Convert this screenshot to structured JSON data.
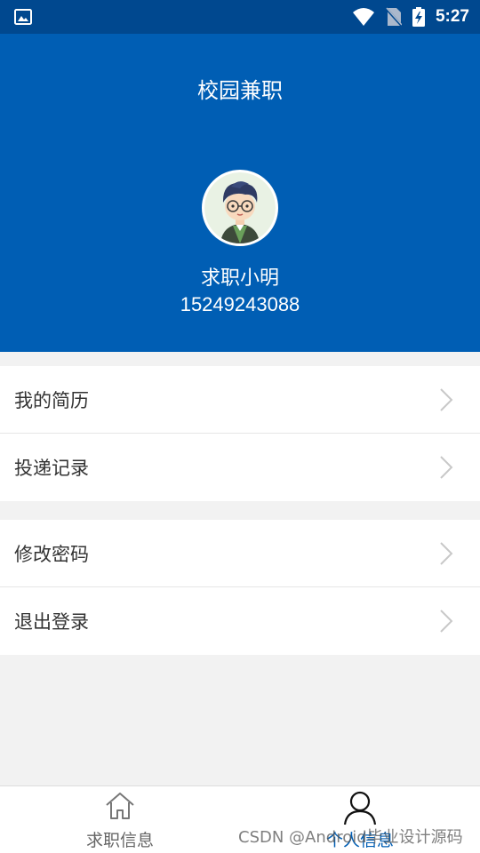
{
  "status_bar": {
    "time": "5:27",
    "icons": [
      "image-icon",
      "wifi-icon",
      "no-sim-icon",
      "battery-charging-icon"
    ]
  },
  "header": {
    "title": "校园兼职",
    "user_name": "求职小明",
    "phone": "15249243088",
    "background_color": "#005eb4"
  },
  "menu": {
    "group1": [
      {
        "label": "我的简历"
      },
      {
        "label": "投递记录"
      }
    ],
    "group2": [
      {
        "label": "修改密码"
      },
      {
        "label": "退出登录"
      }
    ]
  },
  "bottom_nav": {
    "tabs": [
      {
        "label": "求职信息",
        "icon": "home-icon",
        "active": false
      },
      {
        "label": "个人信息",
        "icon": "person-icon",
        "active": true
      }
    ],
    "active_color": "#005eb4"
  },
  "watermark": "CSDN @Android毕业设计源码"
}
